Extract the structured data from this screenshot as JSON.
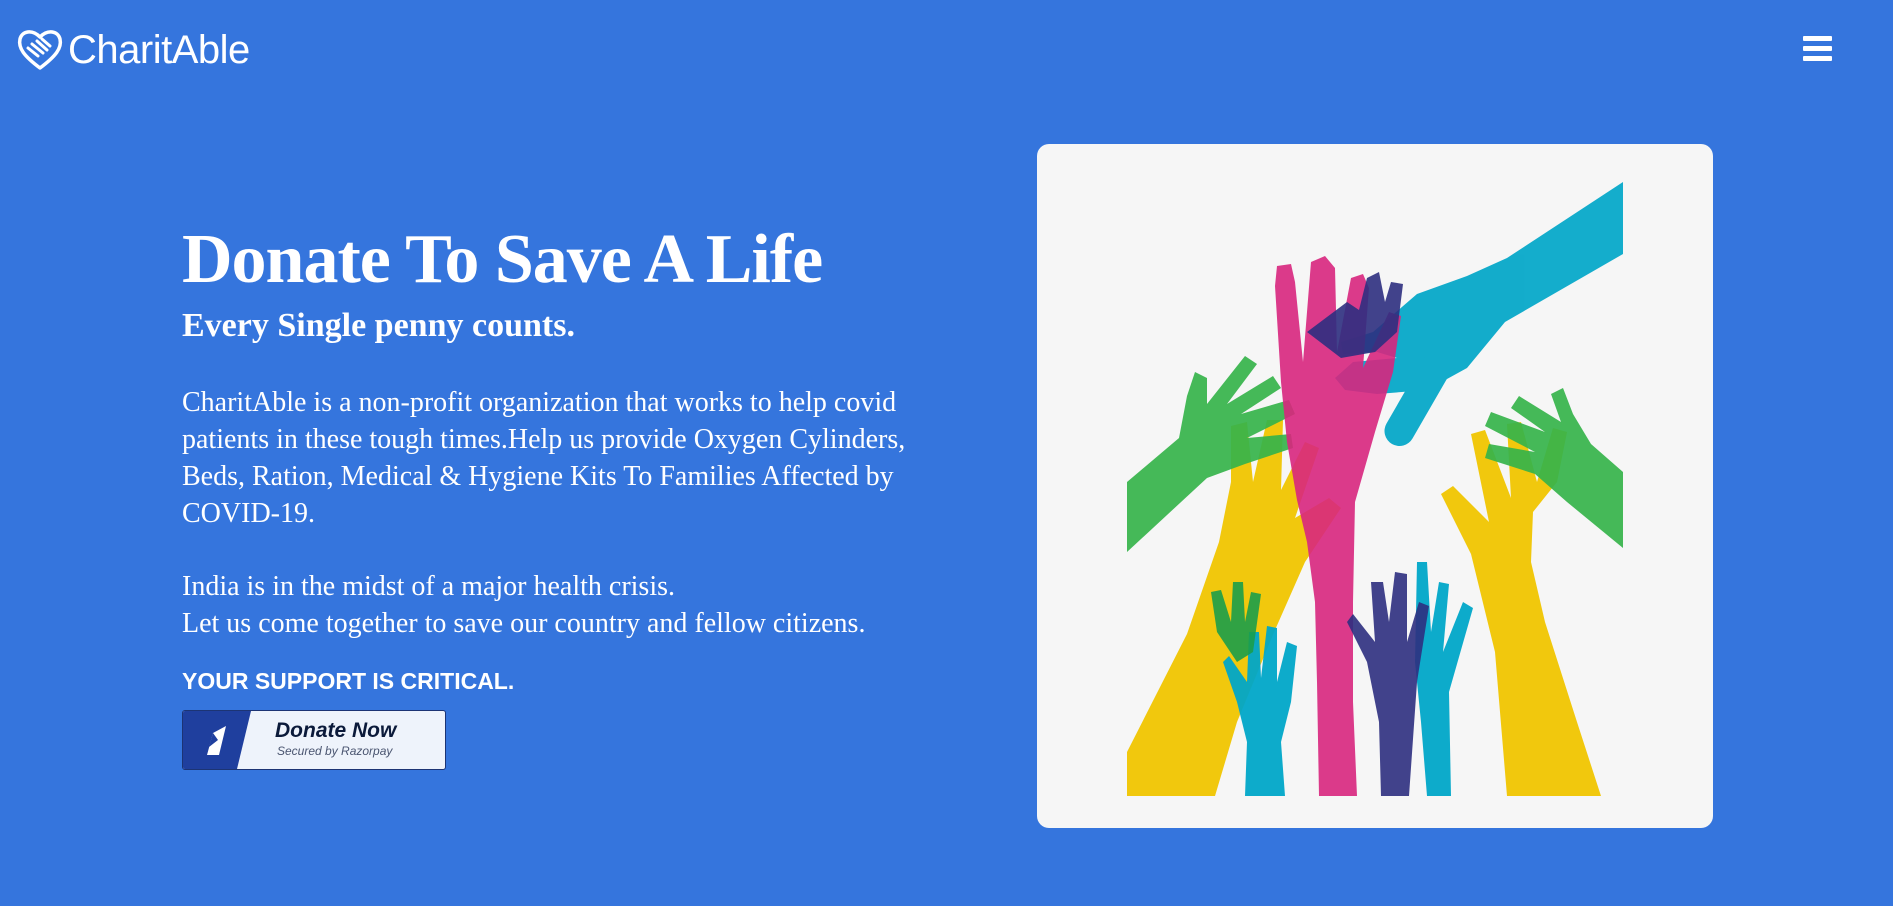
{
  "brand": {
    "name": "CharitAble",
    "logo_icon": "heart-hand-icon"
  },
  "nav": {
    "menu_icon": "hamburger-menu-icon"
  },
  "hero": {
    "title": "Donate To Save A Life",
    "subtitle": "Every Single penny counts.",
    "description": "CharitAble is a non-profit organization that works to help covid patients in these tough times.Help us provide Oxygen Cylinders, Beds, Ration, Medical & Hygiene Kits To Families Affected by COVID-19.",
    "crisis_line1": "India is in the midst of a major health crisis.",
    "crisis_line2": "Let us come together to save our country and fellow citizens.",
    "support": "YOUR SUPPORT IS CRITICAL.",
    "donate_button": {
      "label": "Donate Now",
      "secured": "Secured by Razorpay",
      "icon": "razorpay-logo-icon"
    },
    "illustration": "raised-colorful-hands-illustration"
  },
  "colors": {
    "background": "#3575dd",
    "card": "#f6f6f6",
    "razorpay_blue": "#1f3f9e",
    "hand_cyan": "#00a6c8",
    "hand_magenta": "#d8267e",
    "hand_green": "#35b34a",
    "hand_yellow": "#f0c500",
    "hand_navy": "#2d2f80"
  }
}
